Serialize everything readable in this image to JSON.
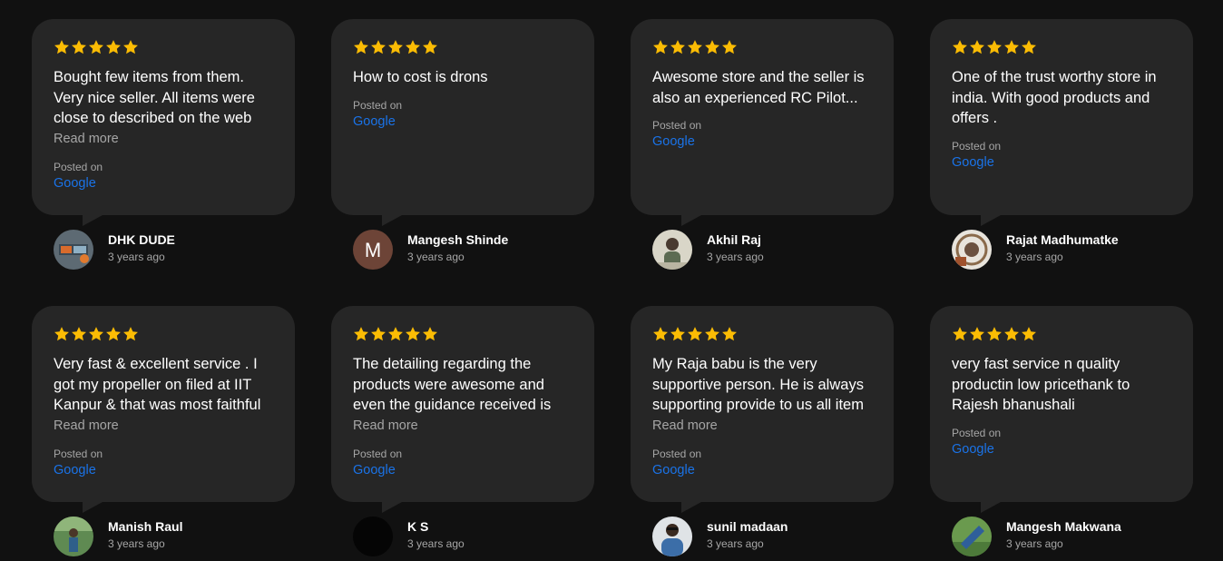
{
  "colors": {
    "background": "#111111",
    "card": "#262626",
    "star": "#fbbc04",
    "link": "#1a73e8",
    "muted": "#a6a6a6"
  },
  "reviews": [
    {
      "rating": 5,
      "text": "Bought few items from them. Very nice seller. All items were close to described on the web and price is",
      "read_more": "Read more",
      "posted_label": "Posted on",
      "source": "Google",
      "name": "DHK DUDE",
      "time": "3 years ago",
      "avatar": "dhk-dude-avatar"
    },
    {
      "rating": 5,
      "text": "How to cost is drons",
      "posted_label": "Posted on",
      "source": "Google",
      "name": "Mangesh Shinde",
      "time": "3 years ago",
      "avatar": "letter-avatar",
      "avatar_letter": "M"
    },
    {
      "rating": 5,
      "text": "Awesome store and the seller is also an experienced RC Pilot...",
      "posted_label": "Posted on",
      "source": "Google",
      "name": "Akhil Raj",
      "time": "3 years ago",
      "avatar": "akhil-raj-avatar"
    },
    {
      "rating": 5,
      "text": "One of the trust worthy store in india. With good products and offers .",
      "posted_label": "Posted on",
      "source": "Google",
      "name": "Rajat Madhumatke",
      "time": "3 years ago",
      "avatar": "rajat-madhumatke-avatar"
    },
    {
      "rating": 5,
      "text": "Very fast & excellent service . I got my propeller on filed at IIT Kanpur & that was most faithful",
      "read_more": "Read more",
      "posted_label": "Posted on",
      "source": "Google",
      "name": "Manish Raul",
      "time": "3 years ago",
      "avatar": "manish-raul-avatar"
    },
    {
      "rating": 5,
      "text": "The detailing regarding the products were awesome and even the guidance received is",
      "read_more": "Read more",
      "posted_label": "Posted on",
      "source": "Google",
      "name": "K S",
      "time": "3 years ago",
      "avatar": "ks-avatar"
    },
    {
      "rating": 5,
      "text": "My Raja babu is the very supportive person. He is always supporting provide to us all item",
      "read_more": "Read more",
      "posted_label": "Posted on",
      "source": "Google",
      "name": "sunil madaan",
      "time": "3 years ago",
      "avatar": "sunil-madaan-avatar"
    },
    {
      "rating": 5,
      "text": "very fast service n quality productin low pricethank to Rajesh bhanushali",
      "posted_label": "Posted on",
      "source": "Google",
      "name": "Mangesh Makwana",
      "time": "3 years ago",
      "avatar": "mangesh-makwana-avatar"
    }
  ]
}
